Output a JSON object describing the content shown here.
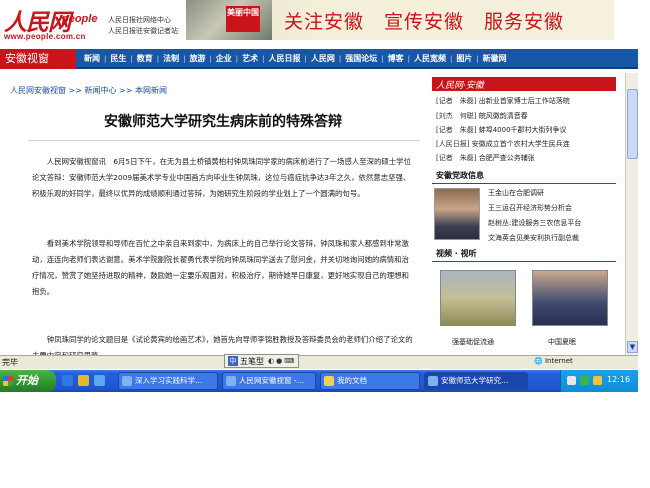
{
  "header": {
    "logo_text": "人民网",
    "logo_people": "people",
    "logo_url": "www.people.com.cn",
    "sub_line1": "人民日报社网络中心",
    "sub_line2": "人民日报驻安徽记者站",
    "banner_seal": "美丽中国",
    "banner_slogan": "关注安徽　宣传安徽　服务安徽"
  },
  "nav": {
    "section": "安徽视窗",
    "items": [
      "新闻",
      "民生",
      "教育",
      "法制",
      "旅游",
      "企业",
      "艺术",
      "人民日报",
      "人民网",
      "强国论坛",
      "博客",
      "人民宽频",
      "图片",
      "新徽网"
    ]
  },
  "article": {
    "breadcrumb": "人民网安徽视窗 >> 新闻中心 >> 本网新闻",
    "title": "安徽师范大学研究生病床前的特殊答辩",
    "p1": "人民网安徽视窗讯　6月5日下午，在无为县土桥镇黄柏村钟凤珠同学家的病床前进行了一场感人至深的硕士学位论文答辩：安徽师范大学2009届美术学专业中国画方向毕业生钟凤珠，这位与癌症抗争达3年之久，依然意志坚强、积极乐观的好同学，最终以优异的成绩顺利通过答辩，为她研究生阶段的学业划上了一个圆满的句号。",
    "p2": "看到美术学院领导和导师在百忙之中亲自来到家中，为病床上的自己举行论文答辩，钟凤珠和家人都感到非常激动，连连向老师们表达谢意。美术学院副院长翟勇代表学院向钟凤珠同学送去了慰问金，并关切地询问她的病情和治疗情况，赞赏了她坚持进取的精神，鼓励她一定要乐观面对，积极治疗，期待她早日康复，更好地实现自己的理想和抱负。",
    "p3": "钟凤珠同学的论文题目是《试论黄宾的绘画艺术》，她首先向导师李锦胜教授及答辩委员会的老师们介绍了论文的主要内容和研究思路。"
  },
  "sidebar": {
    "top_header": "人民网·安徽",
    "news": [
      {
        "source": "[记者　朱磊]",
        "text": "出新业首家博士后工作站落皖"
      },
      {
        "source": "[刘杰　何聪]",
        "text": "皖风徽韵清音春"
      },
      {
        "source": "[记者　朱磊]",
        "text": "蚌埠4000千郡村大街列争议"
      },
      {
        "source": "[人民日报]",
        "text": "安徽成立首个农村大学生民兵连"
      },
      {
        "source": "[记者　朱磊]",
        "text": "合肥严查公务辅张"
      }
    ],
    "gov_header": "安徽党政信息",
    "gov_items": [
      "王金山在合肥调研",
      "王三运召开经济形势分析会",
      "赵树丛:建设服务三农信息平台",
      "文海英会见美安利执行副总裁"
    ],
    "video_header": "视频 · 视听",
    "video_captions": [
      "强基础促流通",
      "中国夏眠"
    ]
  },
  "ime": {
    "label": "五笔型",
    "icon": "中"
  },
  "status": {
    "text": "完毕",
    "zone": "Internet"
  },
  "taskbar": {
    "start": "开始",
    "tasks": [
      "深入学习实践科学…",
      "人民网安徽视窗 -…",
      "我的文档",
      "安徽师范大学研究…"
    ],
    "clock": "12:16"
  },
  "colors": {
    "brand_red": "#c8141a",
    "nav_blue": "#1856a8",
    "taskbar_blue": "#245edb"
  }
}
